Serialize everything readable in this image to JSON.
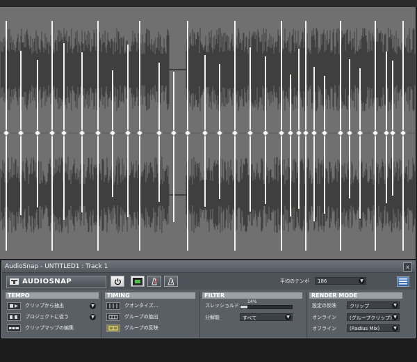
{
  "waveform": {
    "background": "#6f6f6f",
    "wave_color": "#3f3f3f",
    "marker_color": "#f2f2ee"
  },
  "window": {
    "title": "AudioSnap - UNTITLED1 : Track 1",
    "close_label": "x"
  },
  "toolbar": {
    "brand_label": "AUDIOSNAP",
    "tempo_label": "平均のテンポ",
    "tempo_value": "186"
  },
  "tempo": {
    "header": "TEMPO",
    "rows": [
      {
        "label": "クリップから抽出"
      },
      {
        "label": "プロジェクトに従う"
      },
      {
        "label": "クリップマップの編集"
      }
    ]
  },
  "timing": {
    "header": "TIMING",
    "rows": [
      {
        "label": "クオンタイズ..."
      },
      {
        "label": "グループの抽出"
      },
      {
        "label": "グループの反映"
      }
    ]
  },
  "filter": {
    "header": "FILTER",
    "threshold_label": "スレッショルド",
    "threshold_value": "14%",
    "threshold_level": 0.14,
    "resolution_label": "分解能",
    "resolution_value": "すべて"
  },
  "render": {
    "header": "RENDER MODE",
    "rows": [
      {
        "label": "設定の反映",
        "value": "クリップ"
      },
      {
        "label": "オンライン",
        "value": "(グループクリップ)"
      },
      {
        "label": "オフライン",
        "value": "(Radius Mix)"
      }
    ]
  }
}
